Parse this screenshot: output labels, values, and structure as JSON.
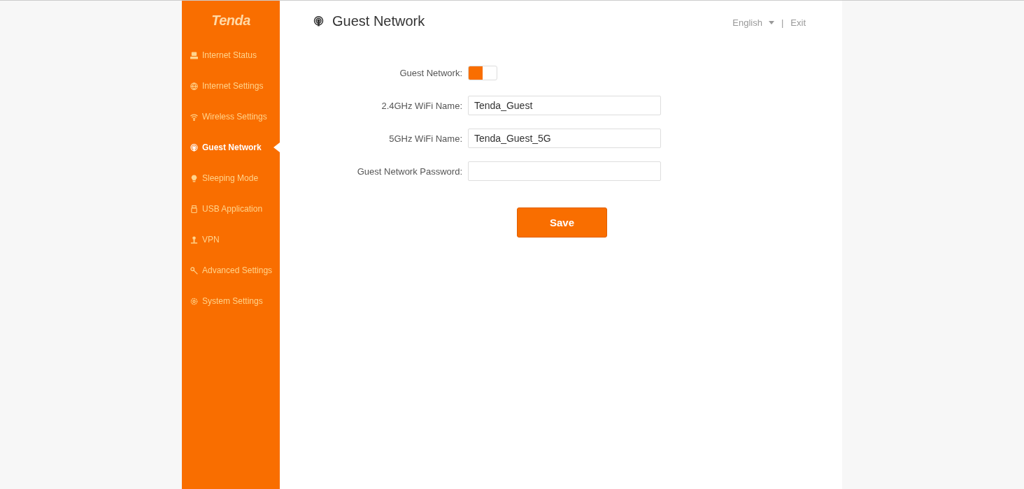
{
  "logo": "Tenda",
  "sidebar": {
    "items": [
      {
        "label": "Internet Status",
        "selected": false
      },
      {
        "label": "Internet Settings",
        "selected": false
      },
      {
        "label": "Wireless Settings",
        "selected": false
      },
      {
        "label": "Guest Network",
        "selected": true
      },
      {
        "label": "Sleeping Mode",
        "selected": false
      },
      {
        "label": "USB Application",
        "selected": false
      },
      {
        "label": "VPN",
        "selected": false
      },
      {
        "label": "Advanced Settings",
        "selected": false
      },
      {
        "label": "System Settings",
        "selected": false
      }
    ]
  },
  "header": {
    "title": "Guest Network",
    "language": "English",
    "separator": "|",
    "exit": "Exit"
  },
  "form": {
    "toggle": {
      "label": "Guest Network:",
      "on": true
    },
    "fields": [
      {
        "label": "2.4GHz WiFi Name:",
        "value": "Tenda_Guest"
      },
      {
        "label": "5GHz WiFi Name:",
        "value": "Tenda_Guest_5G"
      },
      {
        "label": "Guest Network Password:"
      }
    ],
    "save": "Save"
  }
}
